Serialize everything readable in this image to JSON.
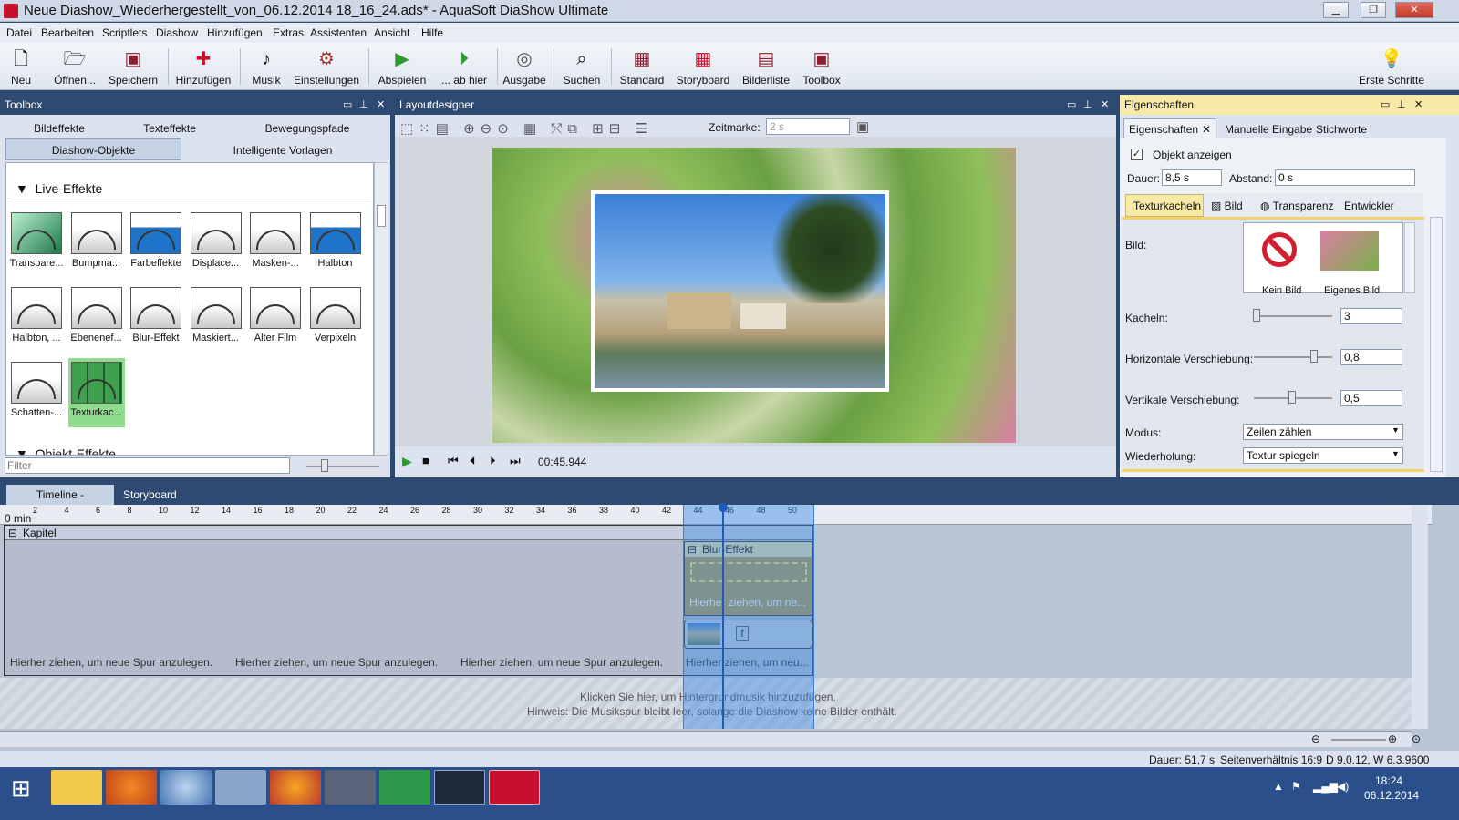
{
  "window": {
    "title": "Neue Diashow_Wiederhergestellt_von_06.12.2014 18_16_24.ads* - AquaSoft DiaShow Ultimate"
  },
  "menu": [
    "Datei",
    "Bearbeiten",
    "Scriptlets",
    "Diashow",
    "Hinzufügen",
    "Extras",
    "Assistenten",
    "Ansicht",
    "Hilfe"
  ],
  "toolbar": {
    "neu": "Neu",
    "oeffnen": "Öffnen...",
    "speichern": "Speichern",
    "hinzufuegen": "Hinzufügen",
    "musik": "Musik",
    "einstellungen": "Einstellungen",
    "abspielen": "Abspielen",
    "abhier": "... ab hier",
    "ausgabe": "Ausgabe",
    "suchen": "Suchen",
    "standard": "Standard",
    "storyboard": "Storyboard",
    "bilderliste": "Bilderliste",
    "toolbox": "Toolbox",
    "erste_schritte": "Erste Schritte"
  },
  "toolbox": {
    "title": "Toolbox",
    "tabs": [
      "Bildeffekte",
      "Texteffekte",
      "Bewegungspfade",
      "Diashow-Objekte",
      "Intelligente Vorlagen"
    ],
    "section_live": "Live-Effekte",
    "section_obj": "Objekt-Effekte",
    "effects": [
      "Transpare...",
      "Bumpma...",
      "Farbeffekte",
      "Displace...",
      "Masken-...",
      "Halbton",
      "Halbton, ...",
      "Ebenenef...",
      "Blur-Effekt",
      "Maskiert...",
      "Alter Film",
      "Verpixeln",
      "Schatten-...",
      "Texturkac..."
    ],
    "filter_placeholder": "Filter"
  },
  "layout": {
    "title": "Layoutdesigner",
    "zeitmarke_label": "Zeitmarke:",
    "zeitmarke_value": "2 s",
    "time": "00:45.944"
  },
  "props": {
    "title": "Eigenschaften",
    "tabs": [
      "Eigenschaften",
      "Manuelle Eingabe",
      "Stichworte"
    ],
    "show_object": "Objekt anzeigen",
    "dauer_label": "Dauer:",
    "dauer": "8,5 s",
    "abstand_label": "Abstand:",
    "abstand": "0 s",
    "subtabs": [
      "Texturkacheln",
      "Bild",
      "Transparenz",
      "Entwickler"
    ],
    "bild_label": "Bild:",
    "kein_bild": "Kein Bild",
    "eigenes_bild": "Eigenes Bild",
    "kacheln_label": "Kacheln:",
    "kacheln": "3",
    "hshift_label": "Horizontale Verschiebung:",
    "hshift": "0,8",
    "vshift_label": "Vertikale Verschiebung:",
    "vshift": "0,5",
    "modus_label": "Modus:",
    "modus": "Zeilen zählen",
    "wiederholung_label": "Wiederholung:",
    "wiederholung": "Textur spiegeln"
  },
  "timeline": {
    "tabs": [
      "Timeline - Spuransicht",
      "Storyboard"
    ],
    "ruler_start": "0 min",
    "ticks": [
      "2",
      "4",
      "6",
      "8",
      "10",
      "12",
      "14",
      "16",
      "18",
      "20",
      "22",
      "24",
      "26",
      "28",
      "30",
      "32",
      "34",
      "36",
      "38",
      "40",
      "42",
      "44",
      "46",
      "48",
      "50"
    ],
    "chapter": "Kapitel",
    "blur": "Blur-Effekt",
    "drop_hint_short": "Hierher ziehen, um ne...",
    "drop_hint": "Hierher ziehen, um neue Spur anzulegen.",
    "drop_hint_cut": "Hierher ziehen, um neu...",
    "music_hint1": "Klicken Sie hier, um Hintergrundmusik hinzuzufügen.",
    "music_hint2": "Hinweis: Die Musikspur bleibt leer, solange die Diashow keine Bilder enthält."
  },
  "status": {
    "dauer": "Dauer: 51,7 s",
    "ratio": "Seitenverhältnis 16:9",
    "version": "D 9.0.12, W 6.3.9600"
  },
  "taskbar": {
    "time": "18:24",
    "date": "06.12.2014"
  }
}
